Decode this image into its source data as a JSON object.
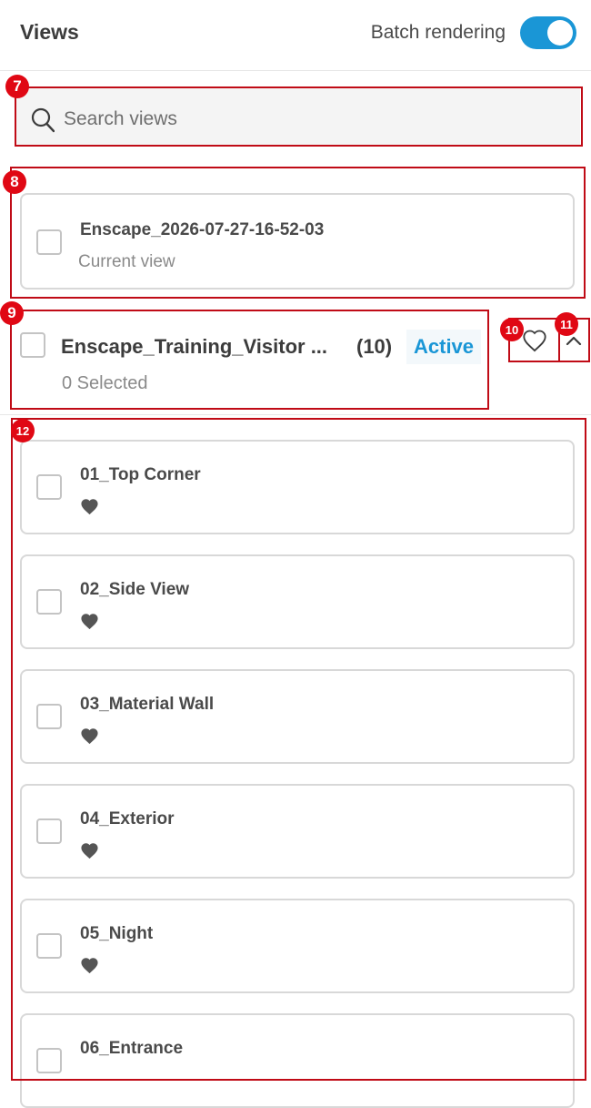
{
  "header": {
    "title": "Views",
    "batch_label": "Batch rendering",
    "batch_enabled": true
  },
  "search": {
    "placeholder": "Search views"
  },
  "current": {
    "name": "Enscape_2026-07-27-16-52-03",
    "subtitle": "Current view"
  },
  "group": {
    "name": "Enscape_Training_Visitor ...",
    "count": "(10)",
    "status": "Active",
    "selected": "0 Selected"
  },
  "views": [
    {
      "name": "01_Top Corner",
      "favorite": true
    },
    {
      "name": "02_Side View",
      "favorite": true
    },
    {
      "name": "03_Material Wall",
      "favorite": true
    },
    {
      "name": "04_Exterior",
      "favorite": true
    },
    {
      "name": "05_Night",
      "favorite": true
    },
    {
      "name": "06_Entrance",
      "favorite": false
    }
  ],
  "markers": {
    "m7": "7",
    "m8": "8",
    "m9": "9",
    "m10": "10",
    "m11": "11",
    "m12": "12"
  },
  "colors": {
    "accent": "#1a96d6",
    "annotation": "#c00b16"
  }
}
